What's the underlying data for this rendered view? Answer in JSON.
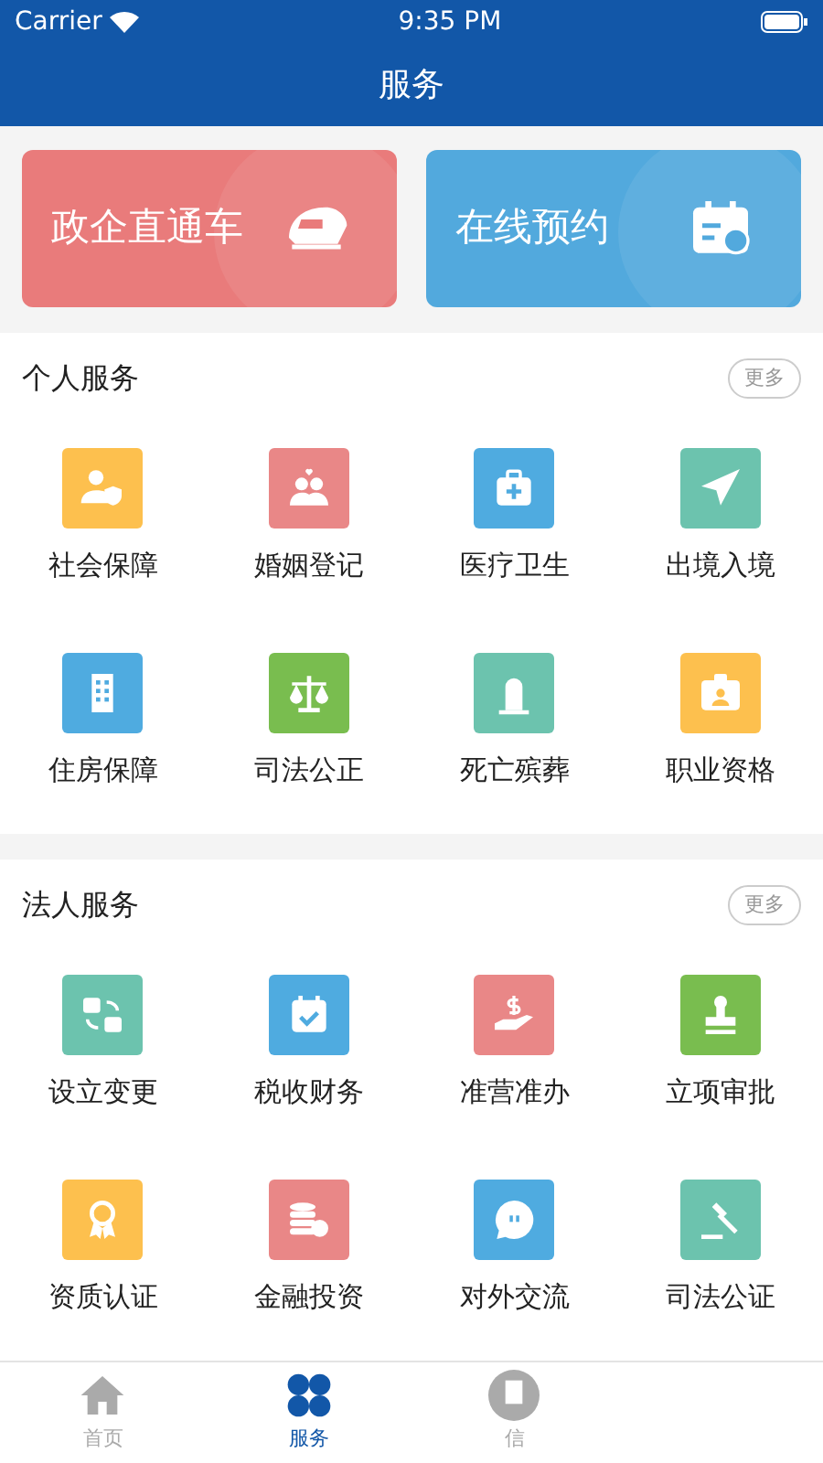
{
  "status_bar": {
    "carrier": "Carrier",
    "time": "9:35 PM"
  },
  "nav": {
    "title": "服务"
  },
  "banners": [
    {
      "label": "政企直通车",
      "color": "#e97b7b"
    },
    {
      "label": "在线预约",
      "color": "#52a9dd"
    }
  ],
  "sections": [
    {
      "title": "个人服务",
      "more": "更多",
      "items": [
        {
          "label": "社会保障",
          "color": "#fdc04e"
        },
        {
          "label": "婚姻登记",
          "color": "#e98787"
        },
        {
          "label": "医疗卫生",
          "color": "#4fabe0"
        },
        {
          "label": "出境入境",
          "color": "#6cc3ae"
        },
        {
          "label": "住房保障",
          "color": "#4fabe0"
        },
        {
          "label": "司法公正",
          "color": "#79bd4f"
        },
        {
          "label": "死亡殡葬",
          "color": "#6cc3ae"
        },
        {
          "label": "职业资格",
          "color": "#fdc04e"
        }
      ]
    },
    {
      "title": "法人服务",
      "more": "更多",
      "items": [
        {
          "label": "设立变更",
          "color": "#6cc3ae"
        },
        {
          "label": "税收财务",
          "color": "#4fabe0"
        },
        {
          "label": "准营准办",
          "color": "#e98787"
        },
        {
          "label": "立项审批",
          "color": "#79bd4f"
        },
        {
          "label": "资质认证",
          "color": "#fdc04e"
        },
        {
          "label": "金融投资",
          "color": "#e98787"
        },
        {
          "label": "对外交流",
          "color": "#4fabe0"
        },
        {
          "label": "司法公证",
          "color": "#6cc3ae"
        }
      ]
    }
  ],
  "tab_bar": [
    {
      "label": "首页",
      "selected": false
    },
    {
      "label": "服务",
      "selected": true
    },
    {
      "label": "信",
      "selected": false
    }
  ]
}
